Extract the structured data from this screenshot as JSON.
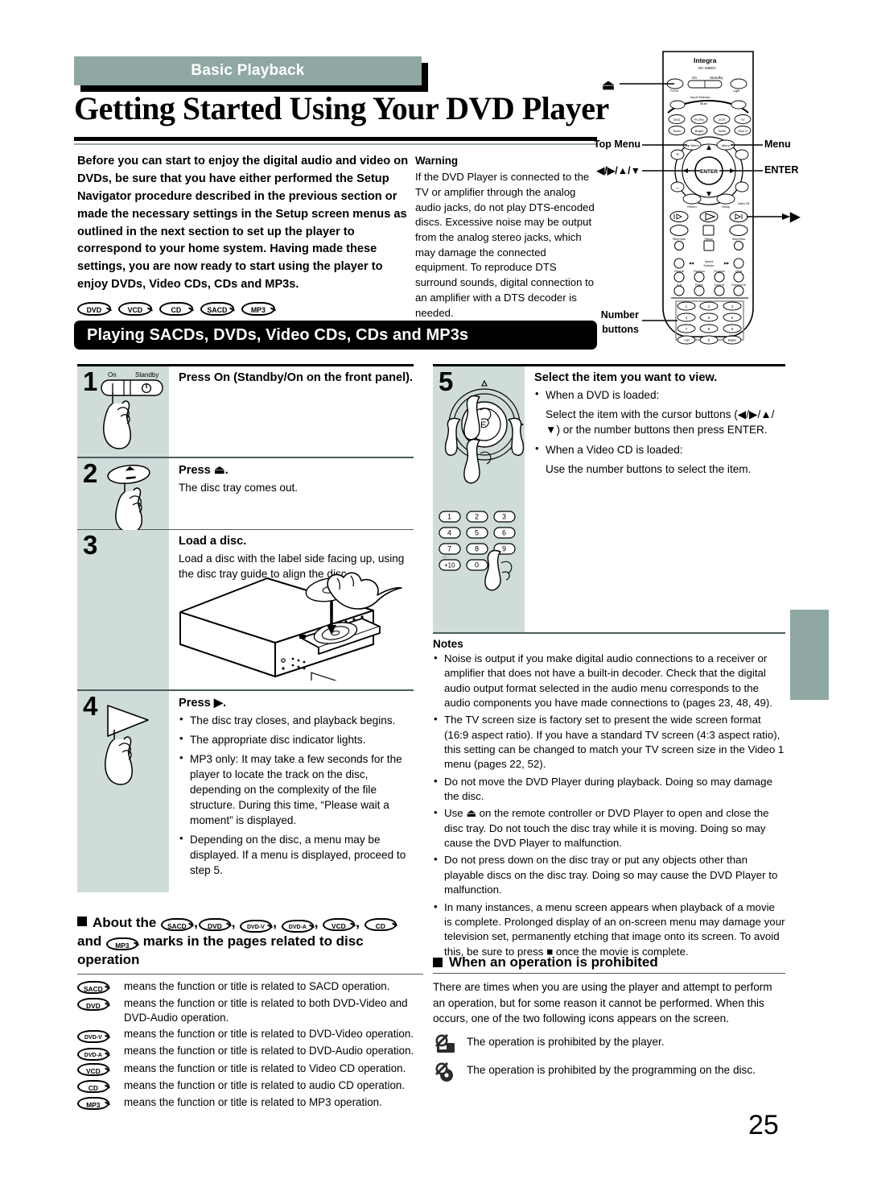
{
  "header": {
    "band_label": "Basic Playback",
    "title": "Getting Started Using Your DVD Player",
    "band_color": "#90a8a4"
  },
  "intro": {
    "text": "Before you can start to enjoy the digital audio and video on DVDs, be sure that you have either performed the Setup Navigator procedure described in the previous section or made the necessary settings in the Setup screen menus as outlined in the next section to set up the player to correspond to your home system. Having made these settings, you are now ready to start using the player to enjoy DVDs, Video CDs, CDs and MP3s."
  },
  "warning": {
    "title": "Warning",
    "text": "If the DVD Player is connected to the TV or amplifier through the analog audio jacks, do not play DTS-encoded discs. Excessive noise may be output from the analog stereo jacks, which may damage the connected equipment. To reproduce DTS surround sounds, digital connection to an amplifier with a DTS decoder is needed."
  },
  "disc_badges": [
    "DVD",
    "VCD",
    "CD",
    "SACD",
    "MP3"
  ],
  "section_bar": {
    "label": "Playing SACDs, DVDs, Video CDs, CDs and MP3s"
  },
  "steps": [
    {
      "num": "1",
      "head": "Press On (Standby/On on the front panel).",
      "sub": "",
      "bullets": [],
      "illustration": "power-button-press",
      "illustration_labels": {
        "on": "On",
        "standby": "Standby"
      }
    },
    {
      "num": "2",
      "head": "Press ⏏.",
      "sub": "The disc tray comes out.",
      "bullets": [],
      "illustration": "eject-button-press"
    },
    {
      "num": "3",
      "head": "Load a disc.",
      "sub": "Load a disc with the label side facing up, using the disc tray guide to align the disc.",
      "bullets": [],
      "illustration": "dvd-player-loading-disc"
    },
    {
      "num": "4",
      "head": "Press ▶.",
      "sub": "",
      "bullets": [
        "The disc tray closes, and playback begins.",
        "The appropriate disc indicator lights.",
        "MP3 only: It may take a few seconds for the player to locate the track on the disc, depending on the complexity of the file structure. During this time, “Please wait a moment” is displayed.",
        "Depending on the disc, a menu may be displayed. If a menu is displayed, proceed to step 5."
      ],
      "illustration": "play-button-press"
    }
  ],
  "step5": {
    "num": "5",
    "head": "Select the item you want to view.",
    "bullets": [
      {
        "lead": "When a DVD is loaded:",
        "body": "Select the item with the cursor buttons (◀/▶/▲/▼) or the number buttons then press ENTER."
      },
      {
        "lead": "When a Video CD is loaded:",
        "body": "Use the number buttons to select the item."
      }
    ],
    "illustration": "cursor-pad-press",
    "keypad": [
      "1",
      "2",
      "3",
      "4",
      "5",
      "6",
      "7",
      "8",
      "9",
      "+10",
      "0"
    ],
    "keypad_shift_label": "+10"
  },
  "notes": {
    "title": "Notes",
    "items": [
      "Noise is output if you make digital audio connections to a receiver or amplifier that does not have a built-in decoder. Check that the digital audio output format selected in the audio menu corresponds to the audio components you have made connections to (pages 23, 48, 49).",
      "The TV screen size is factory set to present the wide screen format (16:9 aspect ratio). If you have a standard TV screen (4:3 aspect ratio), this setting can be changed to match your TV screen size in the Video 1 menu (pages 22, 52).",
      "Do not move the DVD Player during playback. Doing so may damage the disc.",
      "Use ⏏ on the remote controller or DVD Player to open and close the disc tray. Do not touch the disc tray while it is moving. Doing so may cause the DVD Player to malfunction.",
      "Do not press down on the disc tray or put any objects other than playable discs on the disc tray. Doing so may cause the DVD Player to malfunction.",
      "In many instances, a menu screen appears when playback of a movie is complete. Prolonged display of an on-screen menu may damage your television set, permanently etching that image onto its screen. To avoid this, be sure to press ■ once the movie is complete."
    ]
  },
  "prohibited": {
    "title": "When an operation is prohibited",
    "intro": "There are times when you are using the player and attempt to perform an operation, but for some reason it cannot be performed. When this occurs, one of the two following icons appears on the screen.",
    "items": [
      {
        "icon": "prohibited-player-icon",
        "text": "The operation is prohibited by the player."
      },
      {
        "icon": "prohibited-disc-icon",
        "text": "The operation is prohibited by the programming on the disc."
      }
    ]
  },
  "about_marks": {
    "title_prefix": "About the",
    "title_marks_1": [
      "SACD",
      "DVD",
      "DVD-V",
      "DVD-A",
      "VCD",
      "CD"
    ],
    "title_and": "and",
    "title_mark_2": "MP3",
    "title_suffix": "marks in the pages related to disc operation",
    "rows": [
      {
        "mark": "SACD",
        "def": "means the function or title is related to SACD operation."
      },
      {
        "mark": "DVD",
        "def": "means the function or title is related to both DVD-Video and DVD-Audio operation."
      },
      {
        "mark": "DVD-V",
        "def": "means the function or title is related to DVD-Video operation."
      },
      {
        "mark": "DVD-A",
        "def": "means the function or title is related to DVD-Audio operation."
      },
      {
        "mark": "VCD",
        "def": "means the function or title is related to Video CD operation."
      },
      {
        "mark": "CD",
        "def": "means the function or title is related to audio CD operation."
      },
      {
        "mark": "MP3",
        "def": "means the function or title is related to MP3 operation."
      }
    ]
  },
  "remote": {
    "brand": "Integra",
    "model": "RC-499DV",
    "callouts": {
      "eject": "⏏",
      "top_menu": "Top Menu",
      "menu": "Menu",
      "cursor": "◀/▶/▲/▼",
      "enter": "ENTER",
      "play": "▶",
      "number_buttons_line1": "Number",
      "number_buttons_line2": "buttons"
    },
    "keys": {
      "power_on": "On",
      "power_standby": "Standby",
      "enter_label": "ENTER",
      "numbers": [
        "1",
        "2",
        "3",
        "4",
        "5",
        "6",
        "7",
        "8",
        "9",
        "+10",
        "0"
      ]
    }
  },
  "page_number": "25"
}
